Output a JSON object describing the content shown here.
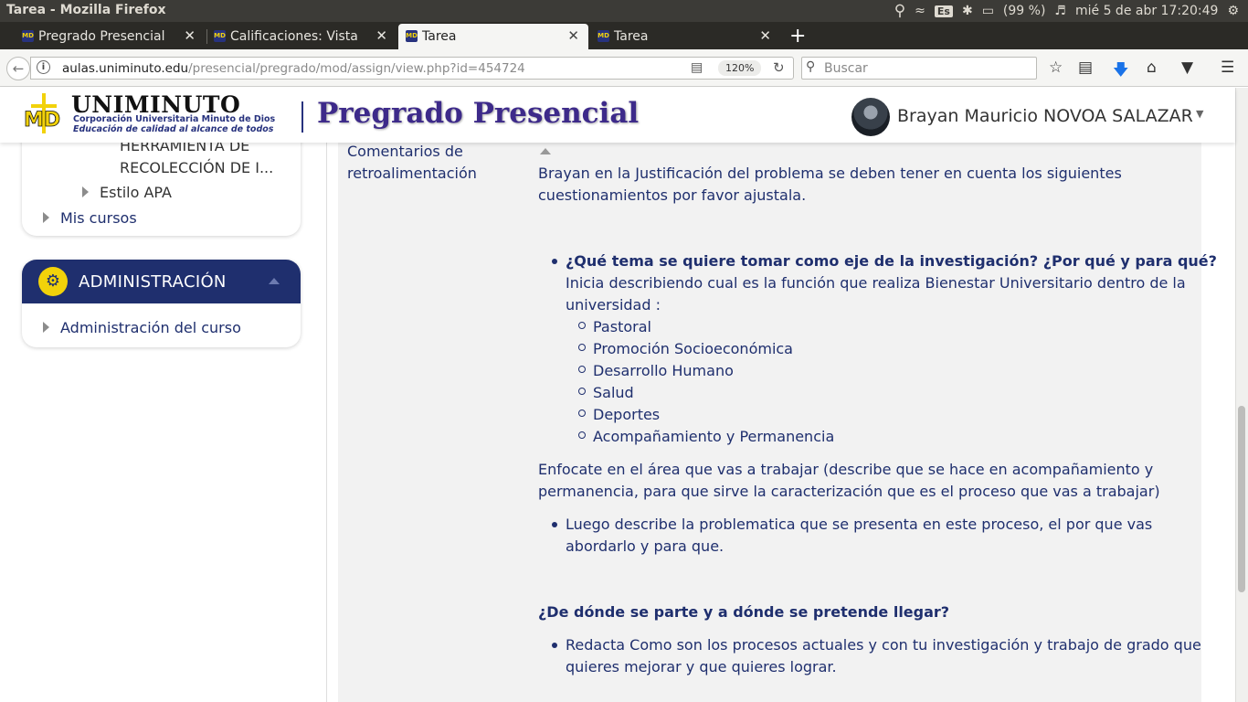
{
  "os": {
    "window_title": "Tarea - Mozilla Firefox",
    "keyboard_layout": "Es",
    "battery": "(99 %)",
    "datetime": "mié  5 de abr 17:20:49"
  },
  "tabs": [
    {
      "label": "Pregrado Presencial"
    },
    {
      "label": "Calificaciones: Vista"
    },
    {
      "label": "Tarea"
    },
    {
      "label": "Tarea"
    }
  ],
  "navbar": {
    "url_host": "aulas.uniminuto.edu",
    "url_path": "/presencial/pregrado/mod/assign/view.php?id=454724",
    "zoom": "120%",
    "search_placeholder": "Buscar"
  },
  "header": {
    "logo_name": "UNIMINUTO",
    "logo_sub1": "Corporación Universitaria Minuto de Dios",
    "logo_sub2": "Educación de calidad al alcance de todos",
    "site_title": "Pregrado Presencial",
    "user_name": "Brayan Mauricio NOVOA SALAZAR"
  },
  "sidebar": {
    "item_line1": "HERRAMIENTA DE",
    "item_line2": "RECOLECCIÓN DE I...",
    "estilo_apa": "Estilo APA",
    "mis_cursos": "Mis cursos",
    "admin_title": "ADMINISTRACIÓN",
    "admin_item": "Administración del curso"
  },
  "feedback": {
    "label_line1": "Comentarios de",
    "label_line2": "retroalimentación",
    "intro_line1": "Brayan en la Justificación del problema se deben tener en cuenta  los siguientes",
    "intro_line2": " cuestionamientos por favor ajustala.",
    "q1": "¿Qué tema se quiere tomar como eje de la investigación? ¿Por qué y para qué?",
    "q1_body_line1": " Inicia describiendo cual es la función que realiza Bienestar  Universitario dentro de la",
    "q1_body_line2": "universidad :",
    "sub_items": [
      "Pastoral",
      "Promoción Socioeconómica",
      "Desarrollo Humano",
      "Salud",
      "Deportes",
      "Acompañamiento y Permanencia"
    ],
    "focus_line1": "Enfocate en el área que vas a trabajar (describe que se hace  en   acompañamiento y",
    "focus_line2": "permanencia, para que sirve la caracterización que es el proceso que vas a trabajar)",
    "bullet2_line1": "Luego describe  la problematica que se presenta en este proceso, el por que vas",
    "bullet2_line2": "abordarlo y para que.",
    "q2": "¿De dónde se parte y a dónde se pretende llegar?",
    "bullet3_line1": "Redacta Como son los procesos actuales y con tu investigación y trabajo de grado que",
    "bullet3_line2": "quieres mejorar y  que quieres lograr."
  }
}
